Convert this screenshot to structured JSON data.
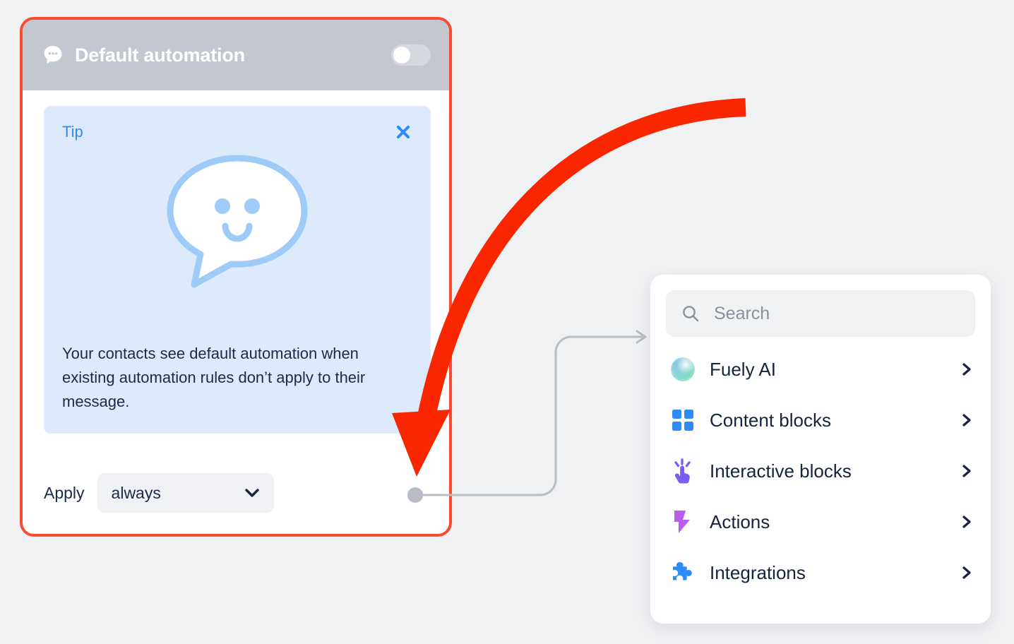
{
  "automation_card": {
    "title": "Default automation",
    "header_icon": "chat-bubble-icon",
    "toggle_state": "off",
    "tip": {
      "label": "Tip",
      "close_icon": "close-icon",
      "illustration": "smiling-speech-bubble-illustration",
      "body": "Your contacts see default automation when existing automation rules don’t apply to their message."
    },
    "apply": {
      "label": "Apply",
      "value": "always",
      "chevron_icon": "chevron-down-icon"
    }
  },
  "block_panel": {
    "search": {
      "placeholder": "Search",
      "value": "",
      "icon": "search-icon"
    },
    "items": [
      {
        "label": "Fuely AI",
        "icon": "sphere-icon",
        "chevron": "chevron-right-icon"
      },
      {
        "label": "Content blocks",
        "icon": "grid-squares-icon",
        "chevron": "chevron-right-icon"
      },
      {
        "label": "Interactive blocks",
        "icon": "tap-hand-icon",
        "chevron": "chevron-right-icon"
      },
      {
        "label": "Actions",
        "icon": "lightning-bolt-icon",
        "chevron": "chevron-right-icon"
      },
      {
        "label": "Integrations",
        "icon": "puzzle-piece-icon",
        "chevron": "chevron-right-icon"
      }
    ]
  },
  "annotation": {
    "arrow_color": "#fa2600",
    "highlight_border_color": "#fa4b32"
  },
  "colors": {
    "canvas": "#f0f1f3",
    "header_bar": "#c3c7d0",
    "tip_bg": "#ddeafb",
    "tip_accent": "#2f8bf5",
    "text_dark": "#16233f",
    "icon_blue": "#2f8bf5",
    "icon_purple": "#7b5cf5",
    "icon_violet": "#bb5cf0",
    "connector": "#b9bcc4"
  }
}
